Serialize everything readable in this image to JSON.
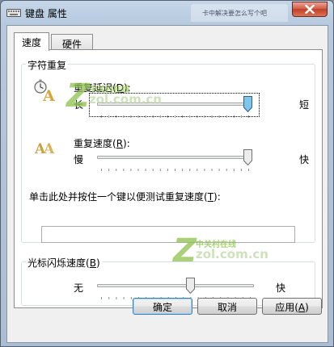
{
  "window": {
    "title": "键盘 属性",
    "background_tab_text": "卡中解决要怎么写个吧"
  },
  "tabs": [
    {
      "label": "速度",
      "active": true
    },
    {
      "label": "硬件",
      "active": false
    }
  ],
  "character_repeat": {
    "group_title": "字符重复",
    "delay": {
      "label_text": "重复延迟",
      "accel": "D",
      "label_suffix": ":",
      "min_label": "长",
      "max_label": "短",
      "level": 1.0
    },
    "rate": {
      "label_text": "重复速度",
      "accel": "R",
      "label_suffix": ":",
      "min_label": "慢",
      "max_label": "快",
      "level": 1.0
    },
    "test": {
      "label_text": "单击此处并按住一个键以便测试重复速度",
      "accel": "T",
      "label_suffix": ":",
      "value": ""
    }
  },
  "cursor_blink": {
    "group_title_text": "光标闪烁速度",
    "accel": "B",
    "min_label": "无",
    "max_label": "快",
    "level": 0.6
  },
  "buttons": {
    "ok": "确定",
    "cancel": "取消",
    "apply_text": "应用",
    "apply_accel": "A"
  },
  "watermark": {
    "cn_text": "中关村在线",
    "url_text": "zol.com.cn"
  },
  "colors": {
    "slider_thumb_focused": "#7fc6ec",
    "watermark_green": "#8ec24d"
  }
}
